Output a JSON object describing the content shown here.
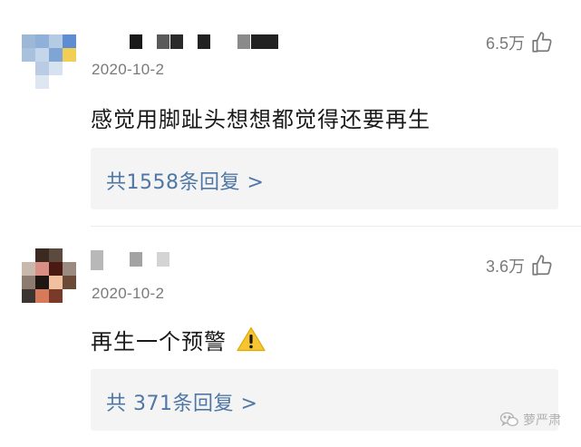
{
  "comments": [
    {
      "date": "2020-10-2",
      "likes": "6.5万",
      "text": "感觉用脚趾头想想都觉得还要再生",
      "replies_label": "共1558条回复 >"
    },
    {
      "date": "2020-10-2",
      "likes": "3.6万",
      "text": "再生一个预警",
      "replies_label": "共 371条回复 >"
    }
  ],
  "icons": {
    "like": "thumbs-up-icon",
    "warning": "warning-icon",
    "wechat": "wechat-icon"
  },
  "watermark": "萝严肃"
}
